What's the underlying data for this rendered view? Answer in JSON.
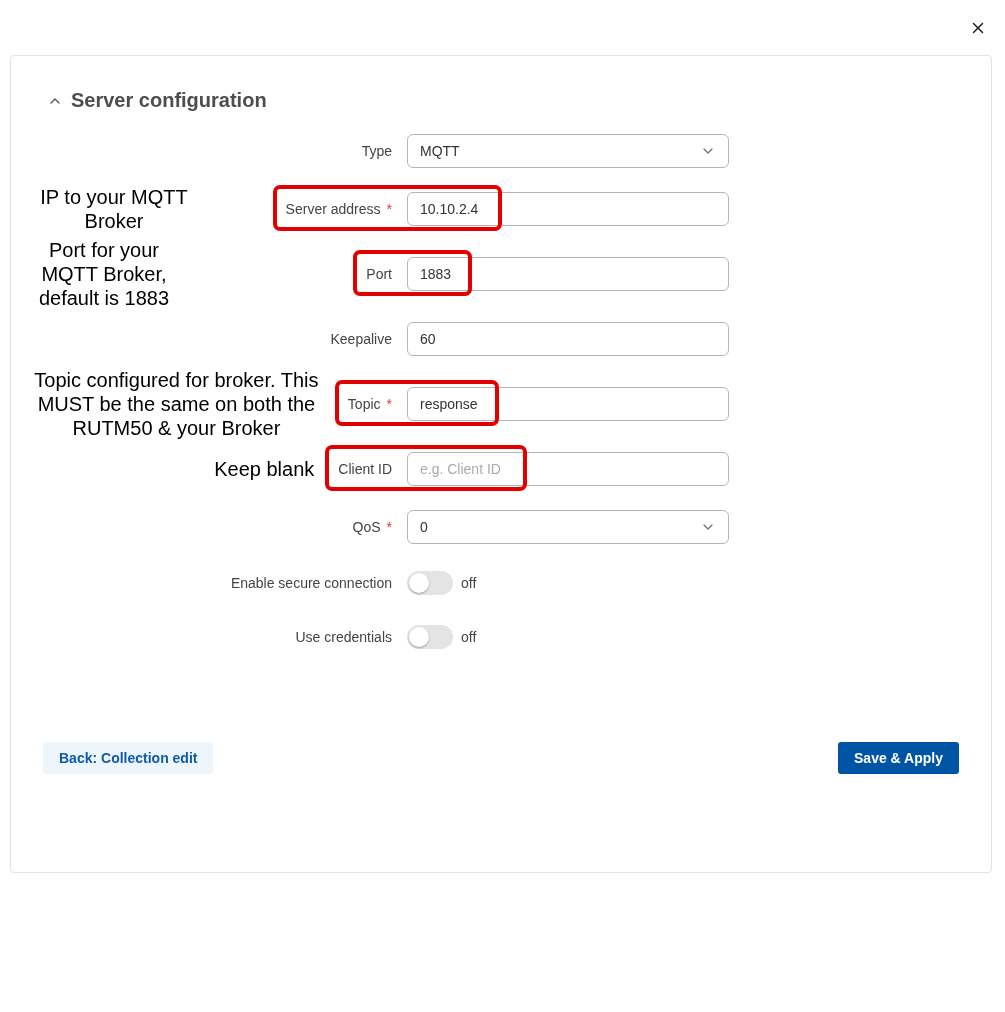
{
  "section": {
    "title": "Server configuration",
    "expanded": true
  },
  "fields": [
    {
      "kind": "select",
      "label": "Type",
      "value": "MQTT",
      "highlighted": false
    },
    {
      "kind": "text",
      "label": "Server address",
      "required_mark": "*",
      "value": "10.10.2.4",
      "highlighted": true,
      "note": "IP to your MQTT Broker"
    },
    {
      "kind": "text",
      "label": "Port",
      "value": "1883",
      "highlighted": true,
      "note": "Port for your MQTT Broker, default is 1883"
    },
    {
      "kind": "text",
      "label": "Keepalive",
      "value": "60",
      "highlighted": false
    },
    {
      "kind": "text",
      "label": "Topic",
      "required_mark": "*",
      "value": "response",
      "highlighted": true,
      "note": "Topic configured for broker. This MUST be the same on both the RUTM50 & your Broker"
    },
    {
      "kind": "text",
      "label": "Client ID",
      "placeholder": "e.g. Client ID",
      "highlighted": true,
      "note": "Keep blank"
    },
    {
      "kind": "select",
      "label": "QoS",
      "required_mark": "*",
      "value": "0",
      "highlighted": false
    },
    {
      "kind": "toggle",
      "label": "Enable secure connection",
      "on": false,
      "state_text": "off"
    },
    {
      "kind": "toggle",
      "label": "Use credentials",
      "on": false,
      "state_text": "off"
    }
  ],
  "buttons": {
    "back": "Back: Collection edit",
    "save": "Save & Apply"
  }
}
